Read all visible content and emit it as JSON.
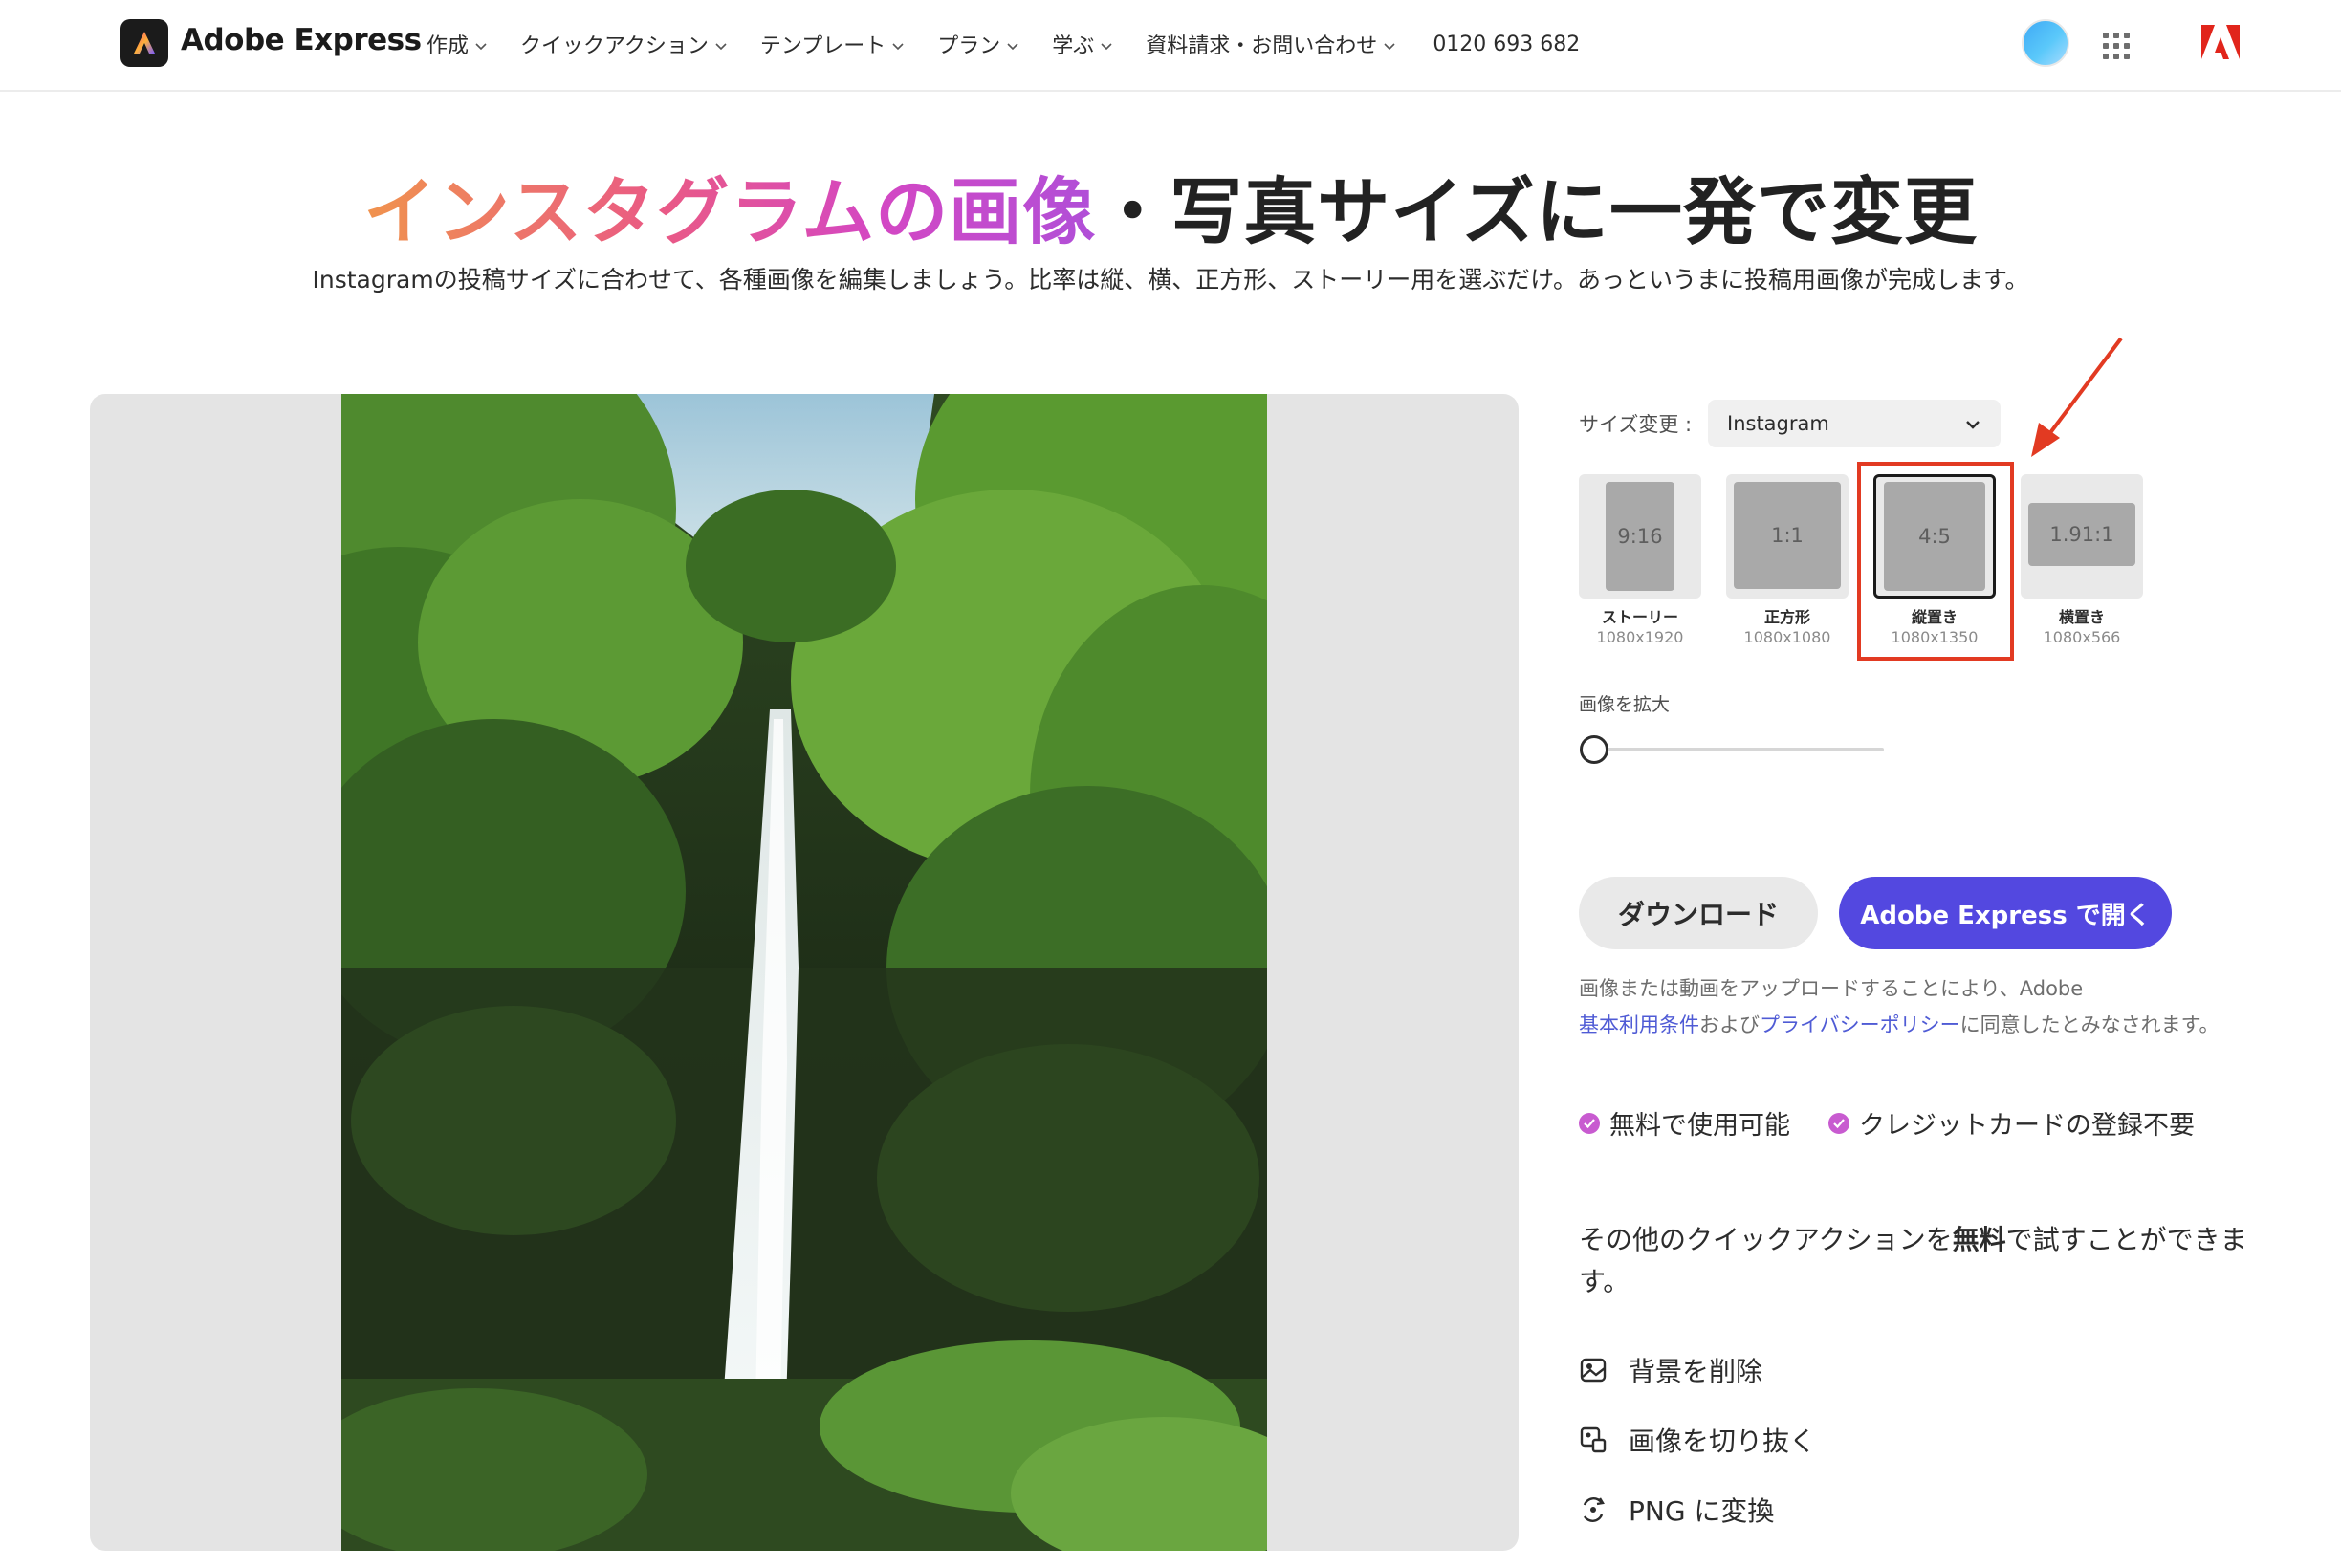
{
  "nav": {
    "brand": "Adobe Express",
    "items": [
      "作成",
      "クイックアクション",
      "テンプレート",
      "プラン",
      "学ぶ",
      "資料請求・お問い合わせ"
    ],
    "phone": "0120 693 682"
  },
  "hero": {
    "title_highlight": "インスタグラムの画像",
    "title_rest": "・写真サイズに一発で変更",
    "subtitle": "Instagramの投稿サイズに合わせて、各種画像を編集しましょう。比率は縦、横、正方形、ストーリー用を選ぶだけ。あっというまに投稿用画像が完成します。"
  },
  "editor": {
    "resize_label": "サイズ変更 :",
    "resize_value": "Instagram",
    "ratios": [
      {
        "ratio": "9:16",
        "name": "ストーリー",
        "dims": "1080x1920"
      },
      {
        "ratio": "1:1",
        "name": "正方形",
        "dims": "1080x1080"
      },
      {
        "ratio": "4:5",
        "name": "縦置き",
        "dims": "1080x1350"
      },
      {
        "ratio": "1.91:1",
        "name": "横置き",
        "dims": "1080x566"
      }
    ],
    "selected_ratio": "4:5",
    "zoom_label": "画像を拡大",
    "zoom_value": 0
  },
  "actions": {
    "download": "ダウンロード",
    "open": "Adobe Express で開く"
  },
  "legal": {
    "text_1": "画像または動画をアップロードすることにより、Adobe",
    "terms_link": "基本利用条件",
    "and": "および",
    "privacy_link": "プライバシーポリシー",
    "text_2": "に同意したとみなされます。"
  },
  "benefits": [
    "無料で使用可能",
    "クレジットカードの登録不要"
  ],
  "more": {
    "text_1": "その他のクイックアクションを",
    "bold": "無料",
    "text_2": "で試すことができます。",
    "actions": [
      "背景を削除",
      "画像を切り抜く",
      "PNG に変換"
    ]
  },
  "colors": {
    "accent": "#5348e0",
    "highlight_box": "#e23a22",
    "check": "#c85bd0",
    "link": "#4f5bd5"
  }
}
